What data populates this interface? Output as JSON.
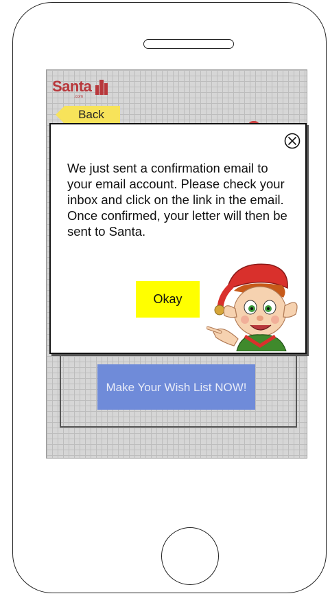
{
  "app": {
    "logo_text": "Santa",
    "logo_sub": ".com"
  },
  "nav": {
    "back_label": "Back"
  },
  "main": {
    "wish_button_label": "Make Your Wish List NOW!"
  },
  "modal": {
    "message": "We just sent a confirmation email to your email account. Please check your inbox and click on the link in the email.  Once confirmed, your letter will then be sent to Santa.",
    "okay_label": "Okay",
    "close_icon": "close-circle-icon",
    "illustration": "elf-illustration"
  },
  "colors": {
    "logo": "#b8373b",
    "back_button": "#f7e35a",
    "wish_button": "#6f8bd9",
    "okay_button": "#ffff00",
    "screen_bg": "#d6d6d6"
  }
}
